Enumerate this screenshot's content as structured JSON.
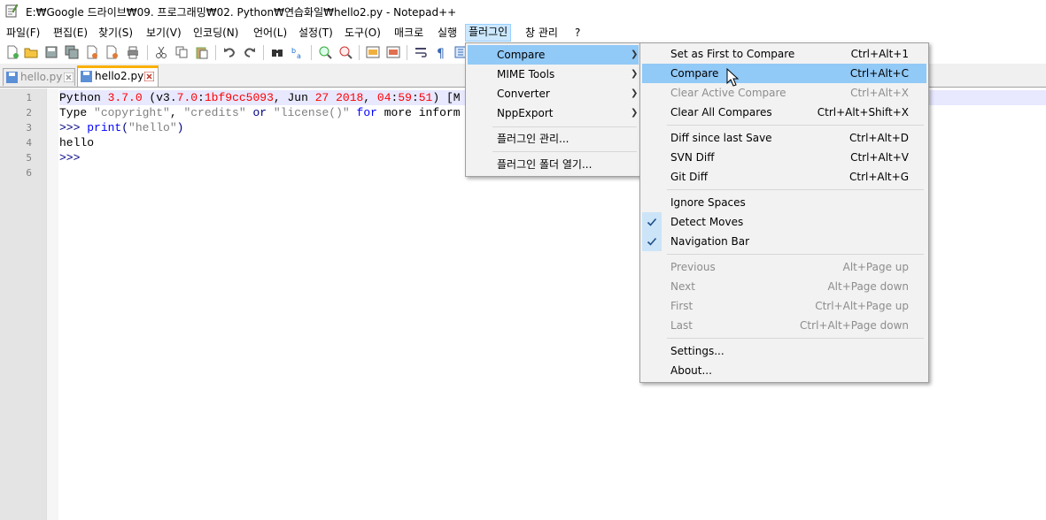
{
  "window": {
    "title": "E:₩Google 드라이브₩09. 프로그래밍₩02. Python₩연습화일₩hello2.py - Notepad++"
  },
  "menubar": [
    {
      "label": "파일(F)"
    },
    {
      "label": "편집(E)"
    },
    {
      "label": "찾기(S)"
    },
    {
      "label": "보기(V)"
    },
    {
      "label": "인코딩(N)"
    },
    {
      "label": "언어(L)"
    },
    {
      "label": "설정(T)"
    },
    {
      "label": "도구(O)"
    },
    {
      "label": "매크로"
    },
    {
      "label": "실행"
    },
    {
      "label": "플러그인"
    },
    {
      "label": "창 관리"
    },
    {
      "label": "?"
    }
  ],
  "tabs": [
    {
      "label": "hello.py",
      "active": false
    },
    {
      "label": "hello2.py",
      "active": true
    }
  ],
  "editor": {
    "line_numbers": [
      "1",
      "2",
      "3",
      "4",
      "5",
      "6"
    ],
    "lines": [
      [
        {
          "t": "Python ",
          "c": "def"
        },
        {
          "t": "3.7.0",
          "c": "num"
        },
        {
          "t": " (v3.",
          "c": "def"
        },
        {
          "t": "7.0",
          "c": "num"
        },
        {
          "t": ":",
          "c": "def"
        },
        {
          "t": "1bf9cc5093",
          "c": "num"
        },
        {
          "t": ", Jun ",
          "c": "def"
        },
        {
          "t": "27 2018",
          "c": "num"
        },
        {
          "t": ", ",
          "c": "def"
        },
        {
          "t": "04",
          "c": "num"
        },
        {
          "t": ":",
          "c": "def"
        },
        {
          "t": "59",
          "c": "num"
        },
        {
          "t": ":",
          "c": "def"
        },
        {
          "t": "51",
          "c": "num"
        },
        {
          "t": ") [M",
          "c": "def"
        }
      ],
      [
        {
          "t": "Type ",
          "c": "def"
        },
        {
          "t": "\"copyright\"",
          "c": "str"
        },
        {
          "t": ", ",
          "c": "def"
        },
        {
          "t": "\"credits\"",
          "c": "str"
        },
        {
          "t": " or ",
          "c": "op"
        },
        {
          "t": "\"license()\"",
          "c": "str"
        },
        {
          "t": " for ",
          "c": "kw"
        },
        {
          "t": "more inform",
          "c": "def"
        }
      ],
      [
        {
          "t": ">>> ",
          "c": "op"
        },
        {
          "t": "print",
          "c": "kw"
        },
        {
          "t": "(",
          "c": "op"
        },
        {
          "t": "\"hello\"",
          "c": "str"
        },
        {
          "t": ")",
          "c": "op"
        }
      ],
      [
        {
          "t": "hello",
          "c": "def"
        }
      ],
      [
        {
          "t": ">>>",
          "c": "op"
        }
      ],
      []
    ]
  },
  "plugins_menu": {
    "items": [
      {
        "label": "Compare",
        "submenu": true
      },
      {
        "label": "MIME Tools",
        "submenu": true
      },
      {
        "label": "Converter",
        "submenu": true
      },
      {
        "label": "NppExport",
        "submenu": true
      },
      {
        "label": "플러그인 관리..."
      },
      {
        "label": "플러그인 폴더 열기..."
      }
    ]
  },
  "compare_menu": {
    "items": [
      {
        "label": "Set as First to Compare",
        "shortcut": "Ctrl+Alt+1"
      },
      {
        "label": "Compare",
        "shortcut": "Ctrl+Alt+C"
      },
      {
        "label": "Clear Active Compare",
        "shortcut": "Ctrl+Alt+X"
      },
      {
        "label": "Clear All Compares",
        "shortcut": "Ctrl+Alt+Shift+X"
      },
      {
        "label": "Diff since last Save",
        "shortcut": "Ctrl+Alt+D"
      },
      {
        "label": "SVN Diff",
        "shortcut": "Ctrl+Alt+V"
      },
      {
        "label": "Git Diff",
        "shortcut": "Ctrl+Alt+G"
      },
      {
        "label": "Ignore Spaces",
        "shortcut": ""
      },
      {
        "label": "Detect Moves",
        "shortcut": "",
        "checked": true
      },
      {
        "label": "Navigation Bar",
        "shortcut": "",
        "checked": true
      },
      {
        "label": "Previous",
        "shortcut": "Alt+Page up"
      },
      {
        "label": "Next",
        "shortcut": "Alt+Page down"
      },
      {
        "label": "First",
        "shortcut": "Ctrl+Alt+Page up"
      },
      {
        "label": "Last",
        "shortcut": "Ctrl+Alt+Page down"
      },
      {
        "label": "Settings...",
        "shortcut": ""
      },
      {
        "label": "About...",
        "shortcut": ""
      }
    ]
  },
  "colors": {
    "highlight": "#91c9f7",
    "tab_accent": "#fab000",
    "current_line": "#e8e8ff"
  }
}
